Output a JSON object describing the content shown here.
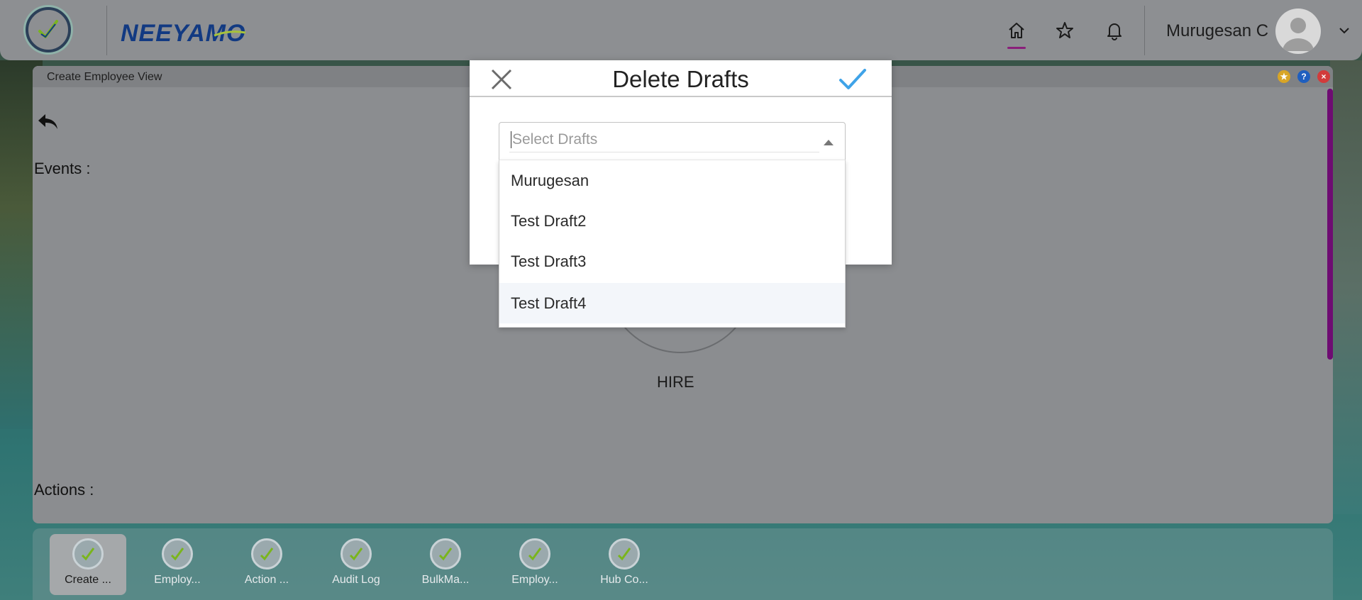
{
  "header": {
    "brand": "NEEYAMO",
    "user_name": "Murugesan C"
  },
  "window": {
    "title": "Create Employee View",
    "events_label": "Events :",
    "actions_label": "Actions :",
    "hire_label": "HIRE"
  },
  "modal": {
    "title": "Delete Drafts",
    "select_placeholder": "Select Drafts",
    "options": [
      "Murugesan",
      "Test Draft2",
      "Test Draft3",
      "Test Draft4"
    ]
  },
  "taskbar": {
    "items": [
      "Create ...",
      "Employ...",
      "Action ...",
      "Audit Log",
      "BulkMa...",
      "Employ...",
      "Hub Co..."
    ]
  },
  "colors": {
    "accent": "#8a1f7a",
    "brand": "#123a82",
    "confirm": "#3fa3e8"
  }
}
